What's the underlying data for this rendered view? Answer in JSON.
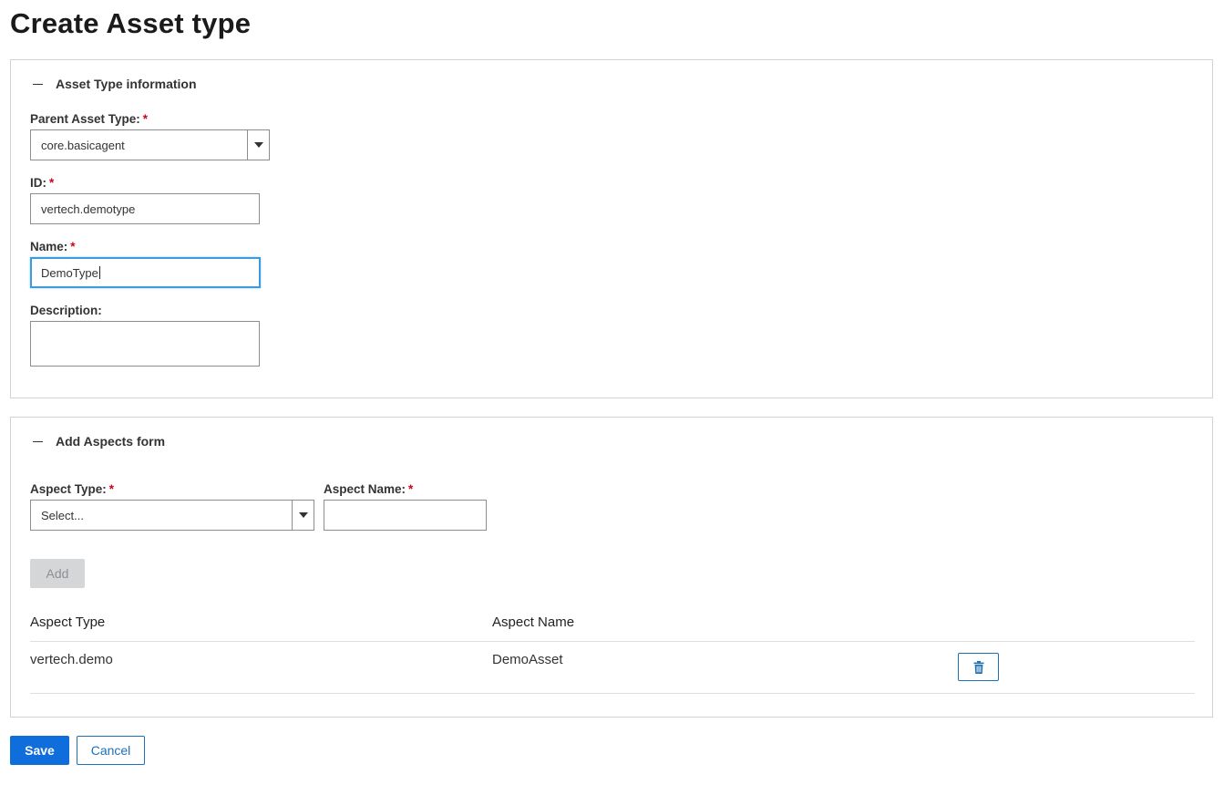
{
  "page": {
    "title": "Create Asset type"
  },
  "asset_type_section": {
    "header": "Asset Type information",
    "parent_asset_type": {
      "label": "Parent Asset Type:",
      "required_mark": "*",
      "value": "core.basicagent"
    },
    "id": {
      "label": "ID:",
      "required_mark": "*",
      "value": "vertech.demotype"
    },
    "name": {
      "label": "Name:",
      "required_mark": "*",
      "value": "DemoType"
    },
    "description": {
      "label": "Description:",
      "value": ""
    }
  },
  "aspects_section": {
    "header": "Add Aspects form",
    "aspect_type": {
      "label": "Aspect Type:",
      "required_mark": "*",
      "value": "Select..."
    },
    "aspect_name": {
      "label": "Aspect Name:",
      "required_mark": "*",
      "value": ""
    },
    "add_label": "Add",
    "table": {
      "columns": [
        "Aspect Type",
        "Aspect Name"
      ],
      "rows": [
        {
          "aspect_type": "vertech.demo",
          "aspect_name": "DemoAsset"
        }
      ]
    }
  },
  "footer": {
    "save_label": "Save",
    "cancel_label": "Cancel"
  },
  "icons": {
    "collapse": "minus-icon",
    "dropdown": "caret-down-icon",
    "delete": "trash-icon"
  },
  "colors": {
    "primary": "#0f6ddc",
    "required": "#d0021b",
    "focus": "#3a9be0",
    "disabled_bg": "#d4d6d8"
  }
}
